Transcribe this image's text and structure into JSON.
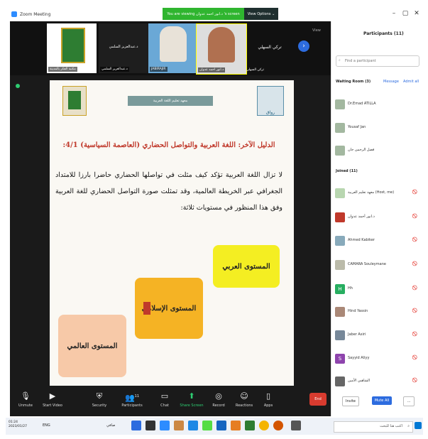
{
  "window": {
    "title": "Zoom Meeting",
    "viewing_banner": "You are viewing د.انور احمد عدوان 's screen",
    "view_options": "View Options ⌄",
    "minimize": "–",
    "maximize": "▢",
    "close": "✕"
  },
  "thumbs": [
    {
      "big": "تركي السهلي",
      "small": "تركي السهلي"
    },
    {
      "label": "د.انور احمد عدوان"
    },
    {
      "label": "JABIRAJIR"
    },
    {
      "label": "د.عبدالعزيز السلمي",
      "top": "د.عبدالعزيز السلمي"
    },
    {
      "label": "مكتبة الفكر بالمدينة"
    }
  ],
  "strip": {
    "view": "View",
    "next": "›"
  },
  "slide": {
    "header_banner": "معهد تعليم اللغة العربية",
    "heading": "الدليل الآخر: اللغة العربية والتواصل الحضاري (العاصمة السياسية) 4/1:",
    "body": "لا تزال اللغة العربية تؤكد كيف مثلت في تواصلها الحضاري حاضرا بارزا للامتداد الجغرافي عبر الخريطة العالمية، وقد تمثلت صورة التواصل الحضاري للغة العربية وفق هذا المنظور في مستويات ثلاثة:",
    "level1": "المستوى العربي",
    "level2": "المستوى الإسلامي",
    "level3": "المستوى العالمي",
    "logo_right": "رواق"
  },
  "toolbar": {
    "unmute": "Unmute",
    "start_video": "Start Video",
    "security": "Security",
    "participants": "Participants",
    "participants_count": "11",
    "chat": "Chat",
    "share_screen": "Share Screen",
    "record": "Record",
    "reactions": "Reactions",
    "apps": "Apps",
    "end": "End"
  },
  "panel": {
    "title": "Participants (11)",
    "search_placeholder": "Find a participant",
    "waiting_label": "Waiting Room (3)",
    "message": "Message",
    "admit_all": "Admit all",
    "waiting": [
      "Dr.Emad ATILLA",
      "Yousaf Jan",
      "فضل الرحمن جان"
    ],
    "joined_label": "Joined (11)",
    "joined": [
      {
        "name": "معهد تعليم العربية (Host, me)",
        "initial": "",
        "color": "#b8d6b0"
      },
      {
        "name": "د.انور أحمد عدوان",
        "initial": "",
        "color": "#c0392b"
      },
      {
        "name": "Ahmed Kabiker",
        "initial": "",
        "color": "#8ab"
      },
      {
        "name": "CAMARA Souleymane",
        "initial": "",
        "color": "#bba"
      },
      {
        "name": "Hh",
        "initial": "H",
        "color": "#27ae60"
      },
      {
        "name": "Hind Yassin",
        "initial": "",
        "color": "#a87"
      },
      {
        "name": "Jaber Asiri",
        "initial": "",
        "color": "#789"
      },
      {
        "name": "Sayyid Aliyy",
        "initial": "S",
        "color": "#8e44ad"
      },
      {
        "name": "الشاهبي الأمين",
        "initial": "",
        "color": "#666"
      }
    ],
    "invite": "Invite",
    "mute_all": "Mute All",
    "more": "..."
  },
  "taskbar": {
    "temp": "صافي",
    "lang": "ENG",
    "search": "اكتب هنا للبحث",
    "time": "01:24",
    "date": "2023/01/27"
  }
}
